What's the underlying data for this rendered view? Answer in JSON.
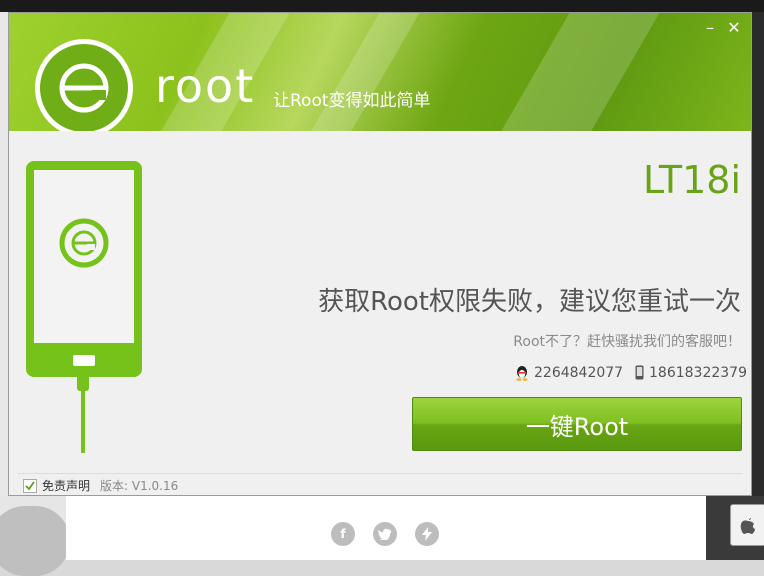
{
  "app": {
    "logo_text": "root",
    "tagline": "让Root变得如此简单",
    "window_controls": {
      "minimize": "–",
      "close": "✕"
    }
  },
  "device": {
    "model": "LT18i"
  },
  "status": {
    "fail_message": "获取Root权限失败，建议您重试一次",
    "help_message": "Root不了？赶快骚扰我们的客服吧！"
  },
  "contacts": {
    "qq": {
      "icon": "qq-penguin-icon",
      "value": "2264842077"
    },
    "phone": {
      "icon": "mobile-phone-icon",
      "value": "18618322379"
    }
  },
  "actions": {
    "root_button_label": "一键Root"
  },
  "footer": {
    "disclaimer_checked": true,
    "disclaimer_label": "免责声明",
    "version_label": "版本: V1.0.16"
  },
  "colors": {
    "brand_green": "#74c21a",
    "title_green": "#6aa31a",
    "button_green": "#68a612"
  }
}
